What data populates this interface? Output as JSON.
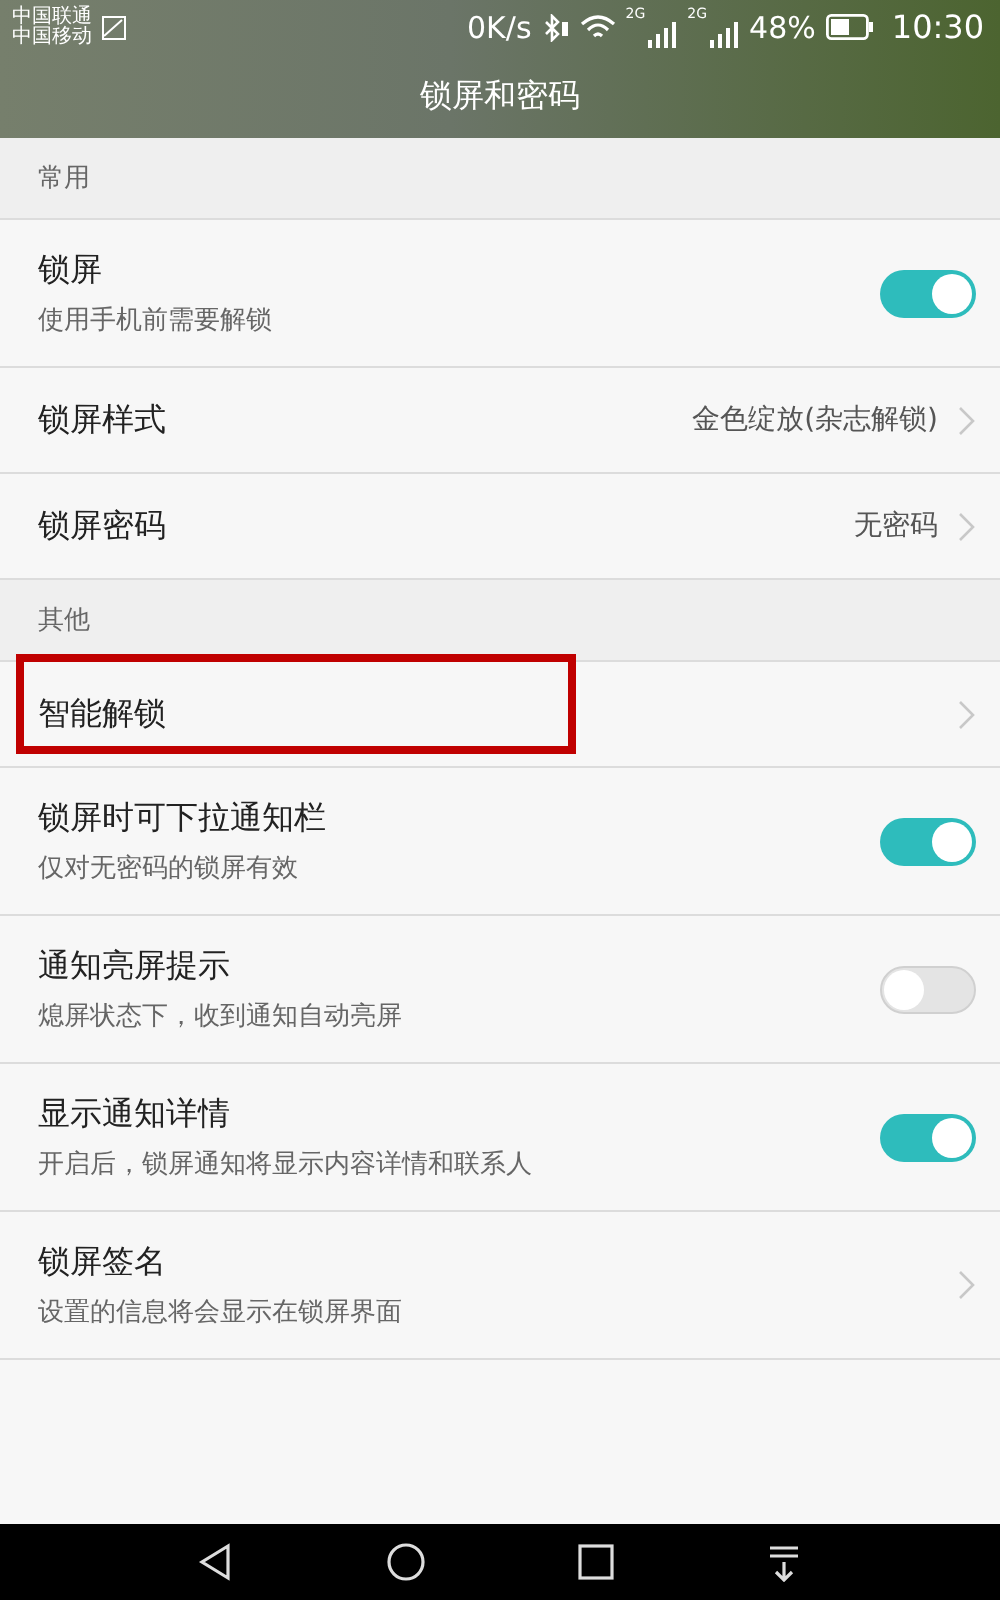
{
  "status_bar": {
    "carriers": [
      "中国联通",
      "中国移动"
    ],
    "speed": "0K/s",
    "network_labels": [
      "2G",
      "2G"
    ],
    "battery": "48%",
    "time": "10:30"
  },
  "title": "锁屏和密码",
  "sections": [
    {
      "header": "常用",
      "items": [
        {
          "kind": "toggle",
          "title": "锁屏",
          "subtitle": "使用手机前需要解锁",
          "on": true
        },
        {
          "kind": "link",
          "title": "锁屏样式",
          "value": "金色绽放(杂志解锁)"
        },
        {
          "kind": "link",
          "title": "锁屏密码",
          "value": "无密码"
        }
      ]
    },
    {
      "header": "其他",
      "items": [
        {
          "kind": "link",
          "title": "智能解锁",
          "highlighted": true
        },
        {
          "kind": "toggle",
          "title": "锁屏时可下拉通知栏",
          "subtitle": "仅对无密码的锁屏有效",
          "on": true
        },
        {
          "kind": "toggle",
          "title": "通知亮屏提示",
          "subtitle": "熄屏状态下，收到通知自动亮屏",
          "on": false
        },
        {
          "kind": "toggle",
          "title": "显示通知详情",
          "subtitle": "开启后，锁屏通知将显示内容详情和联系人",
          "on": true
        },
        {
          "kind": "link",
          "title": "锁屏签名",
          "subtitle": "设置的信息将会显示在锁屏界面"
        }
      ]
    }
  ]
}
